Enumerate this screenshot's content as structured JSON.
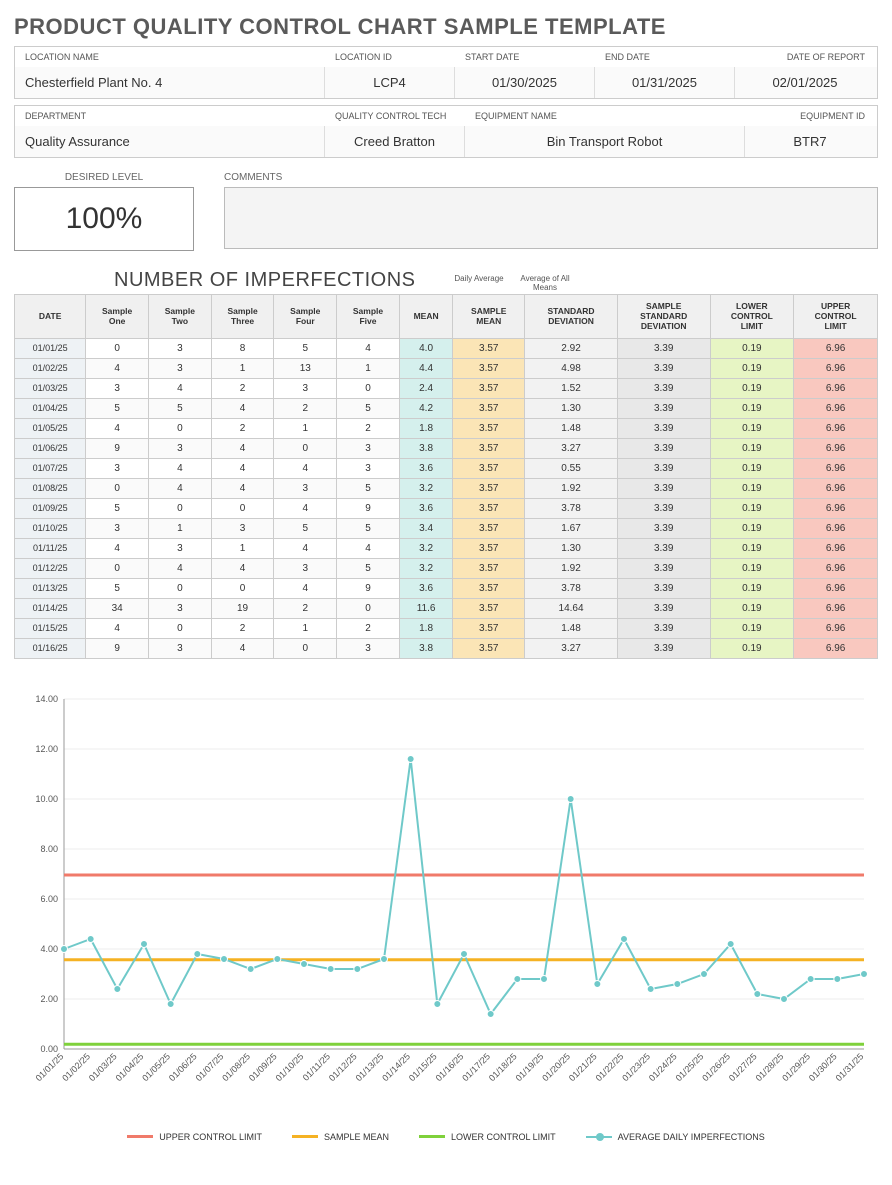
{
  "title": "PRODUCT QUALITY CONTROL CHART SAMPLE TEMPLATE",
  "meta1": {
    "labels": [
      "LOCATION NAME",
      "LOCATION ID",
      "START DATE",
      "END DATE",
      "DATE OF REPORT"
    ],
    "values": [
      "Chesterfield Plant No. 4",
      "LCP4",
      "01/30/2025",
      "01/31/2025",
      "02/01/2025"
    ],
    "widths": [
      310,
      130,
      140,
      140,
      140
    ]
  },
  "meta2": {
    "labels": [
      "DEPARTMENT",
      "QUALITY CONTROL TECH",
      "EQUIPMENT NAME",
      "EQUIPMENT ID"
    ],
    "values": [
      "Quality Assurance",
      "Creed Bratton",
      "Bin Transport Robot",
      "BTR7"
    ],
    "widths": [
      310,
      140,
      280,
      130
    ]
  },
  "desired": {
    "label": "DESIRED LEVEL",
    "value": "100%"
  },
  "comments": {
    "label": "COMMENTS",
    "value": ""
  },
  "section_title": "NUMBER OF IMPERFECTIONS",
  "sub_daily": "Daily Average",
  "sub_all": "Average of All Means",
  "headers": [
    "DATE",
    "Sample One",
    "Sample Two",
    "Sample Three",
    "Sample Four",
    "Sample Five",
    "MEAN",
    "SAMPLE MEAN",
    "STANDARD DEVIATION",
    "SAMPLE STANDARD DEVIATION",
    "LOWER CONTROL LIMIT",
    "UPPER CONTROL LIMIT"
  ],
  "rows": [
    {
      "date": "01/01/25",
      "s": [
        0,
        3,
        8,
        5,
        4
      ],
      "mean": "4.0",
      "smean": "3.57",
      "sd": "2.92",
      "ssd": "3.39",
      "lcl": "0.19",
      "ucl": "6.96"
    },
    {
      "date": "01/02/25",
      "s": [
        4,
        3,
        1,
        13,
        1
      ],
      "mean": "4.4",
      "smean": "3.57",
      "sd": "4.98",
      "ssd": "3.39",
      "lcl": "0.19",
      "ucl": "6.96"
    },
    {
      "date": "01/03/25",
      "s": [
        3,
        4,
        2,
        3,
        0
      ],
      "mean": "2.4",
      "smean": "3.57",
      "sd": "1.52",
      "ssd": "3.39",
      "lcl": "0.19",
      "ucl": "6.96"
    },
    {
      "date": "01/04/25",
      "s": [
        5,
        5,
        4,
        2,
        5
      ],
      "mean": "4.2",
      "smean": "3.57",
      "sd": "1.30",
      "ssd": "3.39",
      "lcl": "0.19",
      "ucl": "6.96"
    },
    {
      "date": "01/05/25",
      "s": [
        4,
        0,
        2,
        1,
        2
      ],
      "mean": "1.8",
      "smean": "3.57",
      "sd": "1.48",
      "ssd": "3.39",
      "lcl": "0.19",
      "ucl": "6.96"
    },
    {
      "date": "01/06/25",
      "s": [
        9,
        3,
        4,
        0,
        3
      ],
      "mean": "3.8",
      "smean": "3.57",
      "sd": "3.27",
      "ssd": "3.39",
      "lcl": "0.19",
      "ucl": "6.96"
    },
    {
      "date": "01/07/25",
      "s": [
        3,
        4,
        4,
        4,
        3
      ],
      "mean": "3.6",
      "smean": "3.57",
      "sd": "0.55",
      "ssd": "3.39",
      "lcl": "0.19",
      "ucl": "6.96"
    },
    {
      "date": "01/08/25",
      "s": [
        0,
        4,
        4,
        3,
        5
      ],
      "mean": "3.2",
      "smean": "3.57",
      "sd": "1.92",
      "ssd": "3.39",
      "lcl": "0.19",
      "ucl": "6.96"
    },
    {
      "date": "01/09/25",
      "s": [
        5,
        0,
        0,
        4,
        9
      ],
      "mean": "3.6",
      "smean": "3.57",
      "sd": "3.78",
      "ssd": "3.39",
      "lcl": "0.19",
      "ucl": "6.96"
    },
    {
      "date": "01/10/25",
      "s": [
        3,
        1,
        3,
        5,
        5
      ],
      "mean": "3.4",
      "smean": "3.57",
      "sd": "1.67",
      "ssd": "3.39",
      "lcl": "0.19",
      "ucl": "6.96"
    },
    {
      "date": "01/11/25",
      "s": [
        4,
        3,
        1,
        4,
        4
      ],
      "mean": "3.2",
      "smean": "3.57",
      "sd": "1.30",
      "ssd": "3.39",
      "lcl": "0.19",
      "ucl": "6.96"
    },
    {
      "date": "01/12/25",
      "s": [
        0,
        4,
        4,
        3,
        5
      ],
      "mean": "3.2",
      "smean": "3.57",
      "sd": "1.92",
      "ssd": "3.39",
      "lcl": "0.19",
      "ucl": "6.96"
    },
    {
      "date": "01/13/25",
      "s": [
        5,
        0,
        0,
        4,
        9
      ],
      "mean": "3.6",
      "smean": "3.57",
      "sd": "3.78",
      "ssd": "3.39",
      "lcl": "0.19",
      "ucl": "6.96"
    },
    {
      "date": "01/14/25",
      "s": [
        34,
        3,
        19,
        2,
        0
      ],
      "mean": "11.6",
      "smean": "3.57",
      "sd": "14.64",
      "ssd": "3.39",
      "lcl": "0.19",
      "ucl": "6.96"
    },
    {
      "date": "01/15/25",
      "s": [
        4,
        0,
        2,
        1,
        2
      ],
      "mean": "1.8",
      "smean": "3.57",
      "sd": "1.48",
      "ssd": "3.39",
      "lcl": "0.19",
      "ucl": "6.96"
    },
    {
      "date": "01/16/25",
      "s": [
        9,
        3,
        4,
        0,
        3
      ],
      "mean": "3.8",
      "smean": "3.57",
      "sd": "3.27",
      "ssd": "3.39",
      "lcl": "0.19",
      "ucl": "6.96"
    }
  ],
  "chart_data": {
    "type": "line",
    "title": "",
    "xlabel": "",
    "ylabel": "",
    "ylim": [
      0,
      14
    ],
    "yticks": [
      0,
      2,
      4,
      6,
      8,
      10,
      12,
      14
    ],
    "categories": [
      "01/01/25",
      "01/02/25",
      "01/03/25",
      "01/04/25",
      "01/05/25",
      "01/06/25",
      "01/07/25",
      "01/08/25",
      "01/09/25",
      "01/10/25",
      "01/11/25",
      "01/12/25",
      "01/13/25",
      "01/14/25",
      "01/15/25",
      "01/16/25",
      "01/17/25",
      "01/18/25",
      "01/19/25",
      "01/20/25",
      "01/21/25",
      "01/22/25",
      "01/23/25",
      "01/24/25",
      "01/25/25",
      "01/26/25",
      "01/27/25",
      "01/28/25",
      "01/29/25",
      "01/30/25",
      "01/31/25"
    ],
    "series": [
      {
        "name": "UPPER CONTROL LIMIT",
        "color": "#f07a6a",
        "type": "const",
        "value": 6.96
      },
      {
        "name": "SAMPLE MEAN",
        "color": "#f5b223",
        "type": "const",
        "value": 3.57
      },
      {
        "name": "LOWER CONTROL LIMIT",
        "color": "#7fd13b",
        "type": "const",
        "value": 0.19
      },
      {
        "name": "AVERAGE DAILY IMPERFECTIONS",
        "color": "#6fc9c9",
        "type": "points",
        "values": [
          4.0,
          4.4,
          2.4,
          4.2,
          1.8,
          3.8,
          3.6,
          3.2,
          3.6,
          3.4,
          3.2,
          3.2,
          3.6,
          11.6,
          1.8,
          3.8,
          1.4,
          2.8,
          2.8,
          10.0,
          2.6,
          4.4,
          2.4,
          2.6,
          3.0,
          4.2,
          2.2,
          2.0,
          2.8,
          2.8,
          3.0
        ]
      }
    ]
  },
  "legend": [
    "UPPER CONTROL LIMIT",
    "SAMPLE MEAN",
    "LOWER CONTROL LIMIT",
    "AVERAGE DAILY IMPERFECTIONS"
  ],
  "legend_colors": [
    "#f07a6a",
    "#f5b223",
    "#7fd13b",
    "#6fc9c9"
  ]
}
